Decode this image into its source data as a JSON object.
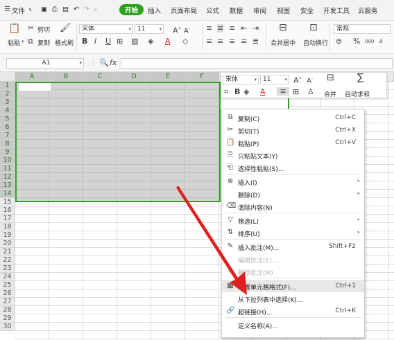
{
  "menubar": {
    "file": "文件",
    "tabs": [
      "开始",
      "插入",
      "页面布局",
      "公式",
      "数据",
      "审阅",
      "视图",
      "安全",
      "开发工具",
      "云服务"
    ],
    "active_tab": "开始",
    "accent": "#2ea121"
  },
  "ribbon": {
    "cut": "剪切",
    "paste": "粘贴",
    "copy": "复制",
    "format_painter": "格式刷",
    "font_name": "宋体",
    "font_size": "11",
    "merge": "合并居中",
    "wrap": "自动换行",
    "number_format": "常规",
    "percent": "%"
  },
  "formula_bar": {
    "cell_ref": "A1",
    "fx": "fx"
  },
  "grid": {
    "columns": [
      "A",
      "B",
      "C",
      "D",
      "E",
      "F"
    ],
    "rows": [
      "1",
      "2",
      "3",
      "4",
      "5",
      "6",
      "7",
      "8",
      "9",
      "10",
      "11",
      "12",
      "13",
      "14",
      "15",
      "16",
      "17",
      "18",
      "19",
      "20",
      "21",
      "22",
      "23",
      "24",
      "25",
      "26",
      "27",
      "28",
      "29",
      "30"
    ],
    "selection_color": "#2ea121"
  },
  "float_toolbar": {
    "font_name": "宋体",
    "font_size": "11",
    "merge": "合并",
    "autosum": "自动求和"
  },
  "context_menu": {
    "items": [
      {
        "icon": "copy-icon",
        "label": "复制(C)",
        "shortcut": "Ctrl+C"
      },
      {
        "icon": "cut-icon",
        "label": "剪切(T)",
        "shortcut": "Ctrl+X"
      },
      {
        "icon": "paste-icon",
        "label": "粘贴(P)",
        "shortcut": "Ctrl+V"
      },
      {
        "icon": "paste-text-icon",
        "label": "只粘贴文本(Y)",
        "shortcut": ""
      },
      {
        "icon": "paste-special-icon",
        "label": "选择性粘贴(S)...",
        "shortcut": ""
      },
      {
        "icon": "insert-icon",
        "label": "插入(I)",
        "shortcut": ""
      },
      {
        "icon": "",
        "label": "删除(D)",
        "shortcut": ""
      },
      {
        "icon": "eraser-icon",
        "label": "清除内容(N)",
        "shortcut": ""
      },
      {
        "icon": "filter-icon",
        "label": "筛选(L)",
        "shortcut": ""
      },
      {
        "icon": "sort-icon",
        "label": "排序(U)",
        "shortcut": ""
      },
      {
        "icon": "comment-icon",
        "label": "插入批注(M)...",
        "shortcut": "Shift+F2"
      },
      {
        "icon": "",
        "label": "编辑批注(E)...",
        "shortcut": ""
      },
      {
        "icon": "delete-comment-icon",
        "label": "删除批注(M)",
        "shortcut": ""
      },
      {
        "icon": "format-cells-icon",
        "label": "设置单元格格式(F)...",
        "shortcut": "Ctrl+1"
      },
      {
        "icon": "",
        "label": "从下拉列表中选择(K)...",
        "shortcut": ""
      },
      {
        "icon": "link-icon",
        "label": "超链接(H)...",
        "shortcut": "Ctrl+K"
      },
      {
        "icon": "",
        "label": "定义名称(A)...",
        "shortcut": ""
      }
    ],
    "arrow_color": "#e02020"
  }
}
